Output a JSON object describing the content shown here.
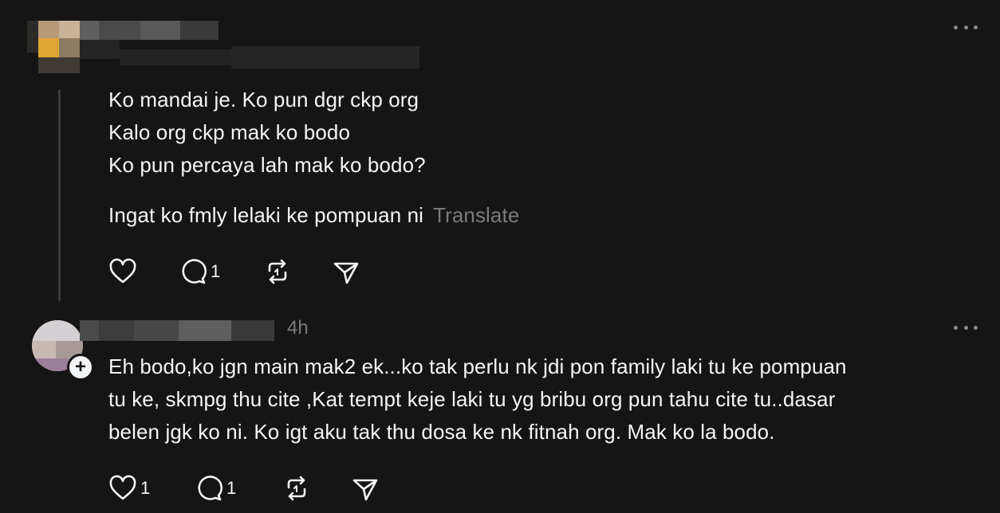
{
  "posts": [
    {
      "lines": [
        "Ko mandai je. Ko pun dgr ckp org",
        "Kalo org ckp mak ko bodo",
        "Ko pun percaya lah mak ko bodo?"
      ],
      "last_line": "Ingat ko fmly lelaki ke pompuan ni",
      "translate_label": "Translate",
      "like_count": "",
      "reply_count": "1",
      "icons": [
        "heart-icon",
        "comment-icon",
        "repost-icon",
        "share-icon",
        "more-icon"
      ]
    },
    {
      "timestamp": "4h",
      "lines": [
        "Eh bodo,ko jgn main mak2 ek...ko tak perlu nk jdi pon family laki tu ke pompuan",
        "tu ke, skmpg thu cite ,Kat tempt keje laki tu yg bribu org pun tahu cite tu..dasar",
        "belen jgk ko ni. Ko igt aku tak thu dosa ke nk fitnah org. Mak ko la bodo."
      ],
      "like_count": "1",
      "reply_count": "1",
      "follow_symbol": "+",
      "icons": [
        "heart-icon",
        "comment-icon",
        "repost-icon",
        "share-icon",
        "more-icon"
      ]
    }
  ],
  "colors": {
    "background": "#151515",
    "text": "#f3f5f7",
    "secondary": "#7b7b7b",
    "thread_line": "#3a3a3a"
  }
}
